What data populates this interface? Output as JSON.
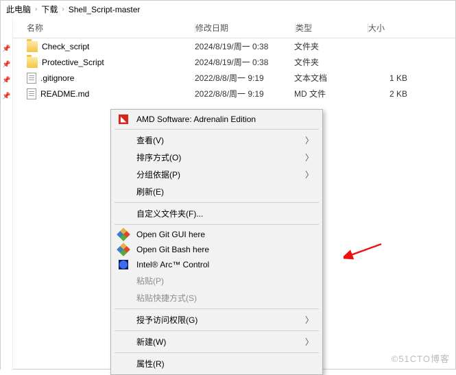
{
  "breadcrumb": {
    "root": "此电脑",
    "mid": "下载",
    "leaf": "Shell_Script-master"
  },
  "columns": {
    "name": "名称",
    "date": "修改日期",
    "type": "类型",
    "size": "大小"
  },
  "files": [
    {
      "name": "Check_script",
      "date": "2024/8/19/周一 0:38",
      "type": "文件夹",
      "size": "",
      "kind": "folder"
    },
    {
      "name": "Protective_Script",
      "date": "2024/8/19/周一 0:38",
      "type": "文件夹",
      "size": "",
      "kind": "folder"
    },
    {
      "name": ".gitignore",
      "date": "2022/8/8/周一 9:19",
      "type": "文本文档",
      "size": "1 KB",
      "kind": "file"
    },
    {
      "name": "README.md",
      "date": "2022/8/8/周一 9:19",
      "type": "MD 文件",
      "size": "2 KB",
      "kind": "file"
    }
  ],
  "context_menu": [
    {
      "label": "AMD Software: Adrenalin Edition",
      "icon": "amd",
      "sub": false
    },
    {
      "sep": true
    },
    {
      "label": "查看(V)",
      "sub": true
    },
    {
      "label": "排序方式(O)",
      "sub": true
    },
    {
      "label": "分组依据(P)",
      "sub": true
    },
    {
      "label": "刷新(E)",
      "sub": false
    },
    {
      "sep": true
    },
    {
      "label": "自定义文件夹(F)...",
      "sub": false
    },
    {
      "sep": true
    },
    {
      "label": "Open Git GUI here",
      "icon": "git",
      "sub": false
    },
    {
      "label": "Open Git Bash here",
      "icon": "git",
      "sub": false
    },
    {
      "label": "Intel® Arc™ Control",
      "icon": "intel",
      "sub": false
    },
    {
      "label": "粘贴(P)",
      "disabled": true,
      "sub": false
    },
    {
      "label": "粘贴快捷方式(S)",
      "disabled": true,
      "sub": false
    },
    {
      "sep": true
    },
    {
      "label": "授予访问权限(G)",
      "sub": true
    },
    {
      "sep": true
    },
    {
      "label": "新建(W)",
      "sub": true
    },
    {
      "sep": true
    },
    {
      "label": "属性(R)",
      "sub": false
    }
  ],
  "watermark": "©51CTO博客"
}
